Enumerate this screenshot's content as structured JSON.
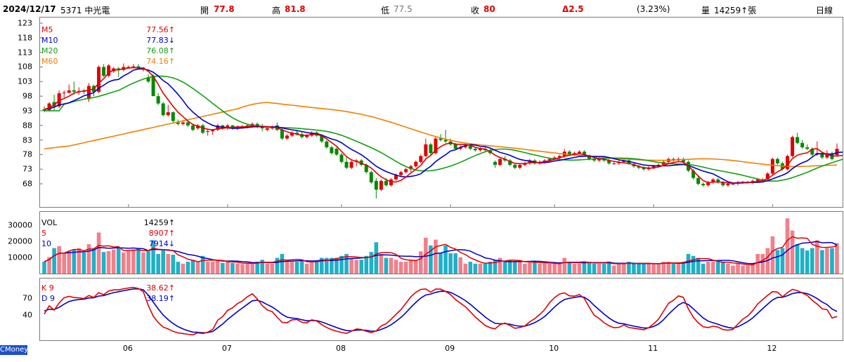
{
  "header": {
    "date": "2024/12/17",
    "stock": "5371 中光電",
    "open_label": "開",
    "open": "77.8",
    "high_label": "高",
    "high": "81.8",
    "low_label": "低",
    "low": "77.5",
    "close_label": "收",
    "close": "80",
    "change": "Δ2.5",
    "change_pct": "(3.23%)",
    "volume_label": "量",
    "volume": "14259↑張",
    "period": "日線"
  },
  "brand": "CMoney",
  "colors": {
    "up": "#e00000",
    "down": "#008a00",
    "ma5": "#e00000",
    "ma10": "#0000c8",
    "ma20": "#12a012",
    "ma60": "#f08000",
    "vol_up": "#f0808a",
    "vol_down": "#20b0c8"
  },
  "chart_data": [
    {
      "type": "candlestick",
      "name": "price",
      "ylim": [
        62,
        123
      ],
      "yticks": [
        "123",
        "118",
        "113",
        "108",
        "103",
        "98",
        "93",
        "88",
        "83",
        "78",
        "73",
        "68"
      ],
      "xticks": [
        "06",
        "07",
        "08",
        "09",
        "10",
        "11",
        "12"
      ],
      "legend": [
        {
          "name": "M5",
          "value": "77.56↑"
        },
        {
          "name": "M10",
          "value": "77.83↓"
        },
        {
          "name": "M20",
          "value": "76.08↑"
        },
        {
          "name": "M60",
          "value": "74.16↑"
        }
      ],
      "ohlc": [
        [
          93.5,
          94.5,
          92.5,
          93
        ],
        [
          93.2,
          96,
          92.8,
          95.5
        ],
        [
          96,
          98.5,
          93,
          94.5
        ],
        [
          94.5,
          100,
          94,
          99
        ],
        [
          99,
          100,
          97.5,
          99.2
        ],
        [
          99.2,
          102,
          98.8,
          100
        ],
        [
          100,
          103,
          98.5,
          99.5
        ],
        [
          99.5,
          101,
          98.5,
          99.8
        ],
        [
          99.8,
          100.5,
          98.8,
          99.5
        ],
        [
          97,
          102.5,
          96,
          101.5
        ],
        [
          101.5,
          102,
          98,
          99.5
        ],
        [
          99.5,
          108.5,
          99,
          108
        ],
        [
          108,
          109,
          104.5,
          105
        ],
        [
          105,
          109,
          104.5,
          108.5
        ],
        [
          106.5,
          108,
          106,
          107.5
        ],
        [
          107.5,
          108,
          104.5,
          107
        ],
        [
          107,
          109.2,
          106.5,
          108
        ],
        [
          107.8,
          108.5,
          107.5,
          108
        ],
        [
          108,
          109,
          107.5,
          108.2
        ],
        [
          108.2,
          109,
          107,
          107.5
        ],
        [
          107.5,
          108,
          106.5,
          107.8
        ],
        [
          104.5,
          105.5,
          102.5,
          103
        ],
        [
          105,
          105.5,
          98,
          98
        ],
        [
          98,
          99,
          95,
          95.5
        ],
        [
          95.5,
          96,
          91,
          91.5
        ],
        [
          91.5,
          95,
          91,
          92.5
        ],
        [
          92.5,
          92.8,
          89,
          89.5
        ],
        [
          89,
          90,
          88,
          88.5
        ],
        [
          88.5,
          89.5,
          88,
          89
        ],
        [
          89,
          89.5,
          87.5,
          88
        ],
        [
          88,
          88.5,
          86,
          86.5
        ],
        [
          87,
          88.5,
          86.5,
          88
        ],
        [
          88,
          88.5,
          85,
          85.5
        ],
        [
          86,
          86.5,
          84.5,
          86
        ],
        [
          86,
          86.8,
          84.8,
          86.5
        ],
        [
          86.5,
          88.5,
          86,
          88
        ],
        [
          88,
          88.2,
          86.5,
          87
        ],
        [
          87,
          88.5,
          86.5,
          88
        ],
        [
          88,
          88.2,
          86.5,
          87
        ],
        [
          87,
          88,
          86.5,
          87.5
        ],
        [
          87.5,
          88.2,
          86.8,
          87.5
        ],
        [
          87.5,
          88.5,
          87,
          88
        ],
        [
          88,
          89,
          87.2,
          88.5
        ],
        [
          88.5,
          89,
          87,
          87.5
        ],
        [
          87.5,
          88.5,
          86,
          87
        ],
        [
          86.5,
          87.5,
          86,
          87
        ],
        [
          87,
          88,
          86.5,
          87.2
        ],
        [
          88,
          89,
          86,
          86.5
        ],
        [
          86.5,
          87,
          83,
          83.5
        ],
        [
          83.5,
          85,
          83,
          84.5
        ],
        [
          84.5,
          86,
          84,
          85.5
        ],
        [
          85.5,
          86.5,
          84.5,
          85
        ],
        [
          85,
          86,
          83.5,
          84
        ],
        [
          84,
          85,
          83.5,
          84.5
        ],
        [
          84.5,
          86,
          84,
          85.5
        ],
        [
          85.5,
          86,
          84,
          84.5
        ],
        [
          84.5,
          85,
          82,
          82.5
        ],
        [
          82.5,
          83,
          80,
          80.5
        ],
        [
          80.5,
          81,
          78,
          78.5
        ],
        [
          80,
          80.5,
          77.5,
          78
        ],
        [
          78,
          78.5,
          75,
          75.5
        ],
        [
          75.5,
          77,
          73,
          73.5
        ],
        [
          73.5,
          76,
          73,
          75.5
        ],
        [
          75.5,
          76.5,
          74,
          76
        ],
        [
          76,
          76.5,
          74,
          74.5
        ],
        [
          74.5,
          75,
          71.5,
          72
        ],
        [
          72,
          72.5,
          68,
          68.5
        ],
        [
          69,
          70,
          63,
          66
        ],
        [
          66,
          69.5,
          65.5,
          69
        ],
        [
          69,
          70,
          67,
          67.5
        ],
        [
          67.5,
          70,
          67,
          69.5
        ],
        [
          69.5,
          71.5,
          69,
          71
        ],
        [
          71,
          72.5,
          70.5,
          72
        ],
        [
          72,
          73.5,
          71.5,
          73
        ],
        [
          73,
          74.5,
          72,
          74
        ],
        [
          74,
          76,
          73.5,
          75.5
        ],
        [
          75.5,
          78,
          75,
          77.5
        ],
        [
          77.5,
          83.5,
          77,
          81.5
        ],
        [
          81.5,
          82,
          77.5,
          78.5
        ],
        [
          78.5,
          84,
          78,
          83.5
        ],
        [
          83.5,
          85,
          82.5,
          83
        ],
        [
          83,
          86.5,
          82,
          82.5
        ],
        [
          82.5,
          83.5,
          81,
          81.5
        ],
        [
          81.5,
          82,
          79.5,
          80
        ],
        [
          80,
          81,
          79.5,
          80.5
        ],
        [
          80.5,
          81.5,
          80,
          81
        ],
        [
          81,
          81.5,
          79.5,
          80
        ],
        [
          80,
          80.5,
          79,
          79.5
        ],
        [
          79.5,
          80.5,
          79,
          80
        ],
        [
          80,
          80.5,
          79,
          79.5
        ],
        [
          79.5,
          80,
          78,
          78.5
        ],
        [
          75.5,
          76,
          73.5,
          74.5
        ],
        [
          74.5,
          77,
          74,
          76.5
        ],
        [
          76.5,
          77.5,
          75.5,
          76
        ],
        [
          76,
          76.5,
          74,
          74.5
        ],
        [
          74.5,
          75,
          73,
          73.5
        ],
        [
          73.5,
          75,
          73,
          74.5
        ],
        [
          74.5,
          75.5,
          74,
          75
        ],
        [
          75,
          76.5,
          74.5,
          76
        ],
        [
          76,
          76.5,
          74.5,
          75
        ],
        [
          75,
          76,
          74.5,
          75.5
        ],
        [
          75.5,
          76.5,
          75,
          76
        ],
        [
          76,
          77,
          75.5,
          76.5
        ],
        [
          76.5,
          77.5,
          76,
          77
        ],
        [
          77,
          78,
          76.5,
          77.5
        ],
        [
          77.5,
          80,
          77,
          79
        ],
        [
          79,
          79.5,
          77.5,
          78
        ],
        [
          78,
          79,
          77.5,
          78.5
        ],
        [
          78.5,
          79.5,
          78,
          79
        ],
        [
          79,
          79.5,
          77.5,
          77.8
        ],
        [
          77.8,
          78,
          76,
          76.5
        ],
        [
          76.5,
          77,
          75.5,
          76
        ],
        [
          76,
          77,
          75.5,
          76.5
        ],
        [
          76.5,
          77,
          75.5,
          76
        ],
        [
          76,
          76.5,
          74.5,
          75
        ],
        [
          75,
          75.5,
          74.5,
          75
        ],
        [
          75,
          76,
          74.5,
          75.5
        ],
        [
          75.5,
          76.5,
          75,
          76
        ],
        [
          76,
          76.5,
          74.5,
          74.8
        ],
        [
          74.8,
          75,
          73.5,
          74
        ],
        [
          74,
          74.5,
          73,
          73.5
        ],
        [
          73.5,
          74,
          72.5,
          73
        ],
        [
          73,
          74,
          72.5,
          73.5
        ],
        [
          73.5,
          74.5,
          73,
          74
        ],
        [
          74,
          75,
          73.5,
          74.5
        ],
        [
          74.5,
          76,
          74,
          75.5
        ],
        [
          75.5,
          77,
          75,
          76.5
        ],
        [
          76.5,
          77,
          75.5,
          76
        ],
        [
          76,
          77,
          75.5,
          76.5
        ],
        [
          76.5,
          77,
          75,
          75.5
        ],
        [
          75.5,
          76,
          72,
          72.5
        ],
        [
          72.5,
          73,
          69.5,
          70
        ],
        [
          70,
          70.5,
          67.5,
          68
        ],
        [
          68,
          68.5,
          67,
          67.5
        ],
        [
          67.5,
          69,
          67,
          68.5
        ],
        [
          68.5,
          70,
          68,
          69.5
        ],
        [
          69.5,
          70,
          68,
          68.5
        ],
        [
          68.5,
          69,
          67,
          67.5
        ],
        [
          67.5,
          68.5,
          67,
          68
        ],
        [
          68,
          68.5,
          67.5,
          68
        ],
        [
          68,
          69,
          67.5,
          68.5
        ],
        [
          68.5,
          69,
          68,
          68.5
        ],
        [
          68.5,
          69,
          68,
          68.5
        ],
        [
          68.5,
          69.5,
          68,
          69
        ],
        [
          69,
          70,
          68.5,
          69.5
        ],
        [
          69.5,
          70,
          68.5,
          69.5
        ],
        [
          69.5,
          72,
          69,
          71.5
        ],
        [
          71.5,
          77,
          71,
          76.5
        ],
        [
          76.5,
          77,
          74.5,
          75
        ],
        [
          75,
          75.5,
          72.5,
          73
        ],
        [
          73,
          78,
          72.5,
          77.5
        ],
        [
          77.5,
          84.5,
          77,
          84
        ],
        [
          84,
          85.5,
          81.5,
          82
        ],
        [
          82,
          83,
          80,
          80.5
        ],
        [
          80.5,
          81.5,
          79.5,
          80
        ],
        [
          80,
          80.5,
          77.5,
          78
        ],
        [
          78,
          82.5,
          77.5,
          78.5
        ],
        [
          78.5,
          79,
          76.5,
          77
        ],
        [
          77,
          79.5,
          76.5,
          78.5
        ],
        [
          78.5,
          79,
          76,
          76.5
        ],
        [
          77.8,
          81.8,
          77.5,
          80
        ]
      ],
      "ma": {
        "M5": [
          93.5,
          94,
          95,
          96.5,
          97.2,
          98,
          99,
          99.5,
          99.8,
          100,
          100.5,
          102.5,
          104,
          106,
          107,
          107,
          107.4,
          107.6,
          107.8,
          107.7,
          107.6,
          106.5,
          104.8,
          102,
          99,
          96.8,
          94.5,
          92.5,
          91,
          89.5,
          88.3,
          87.8,
          87.1,
          86.7,
          86.5,
          86.8,
          87,
          87.2,
          87.3,
          87.5,
          87.5,
          87.6,
          87.8,
          87.8,
          87.7,
          87.6,
          87.4,
          87.2,
          86.5,
          85.8,
          85.4,
          85,
          84.6,
          84.6,
          84.9,
          85,
          84.4,
          83.4,
          82.1,
          80.9,
          79.1,
          77.3,
          76.2,
          75.7,
          75,
          74.4,
          73.4,
          71.8,
          70.4,
          69.4,
          68.7,
          68.6,
          69.2,
          70.3,
          71.7,
          73,
          74.3,
          76.5,
          77.7,
          79.5,
          80.7,
          81.6,
          82,
          81.6,
          81.5,
          81.5,
          81.2,
          80.5,
          80.1,
          79.9,
          79,
          77.8,
          77,
          76.5,
          75.6,
          75,
          74.9,
          75,
          75.2,
          75.2,
          75.3,
          75.6,
          75.9,
          76.4,
          76.9,
          77.4,
          77.8,
          78.1,
          78.3,
          78,
          77.5,
          77,
          76.6,
          76.4,
          76,
          75.7,
          75.4,
          75.2,
          75,
          74.5,
          74,
          73.5,
          73.4,
          73.4,
          73.8,
          74.3,
          74.9,
          75.3,
          75.6,
          75.4,
          74.2,
          72.4,
          70.7,
          69.1,
          68.4,
          68.6,
          68.6,
          68.5,
          68.3,
          68.2,
          68.2,
          68.3,
          68.4,
          68.6,
          68.8,
          69.1,
          69.8,
          70.9,
          72.1,
          73.1,
          74.4,
          76.6,
          77.8,
          78.3,
          78.6,
          79.9,
          80,
          78.8,
          78,
          77.6,
          77.5,
          77.7,
          77.6
        ]
      }
    },
    {
      "type": "bar",
      "name": "volume",
      "ylim": [
        0,
        38000
      ],
      "yticks": [
        "30000",
        "20000",
        "10000"
      ],
      "legend": [
        {
          "name": "VOL",
          "value": "14259↑"
        },
        {
          "name": "5",
          "value": "8907↑"
        },
        {
          "name": "10",
          "value": "7914↓"
        }
      ]
    },
    {
      "type": "line",
      "name": "KD",
      "ylim": [
        0,
        100
      ],
      "yticks": [
        "70",
        "40"
      ],
      "legend": [
        {
          "name": "K 9",
          "value": "38.62↑"
        },
        {
          "name": "D 9",
          "value": "38.19↑"
        }
      ]
    }
  ]
}
